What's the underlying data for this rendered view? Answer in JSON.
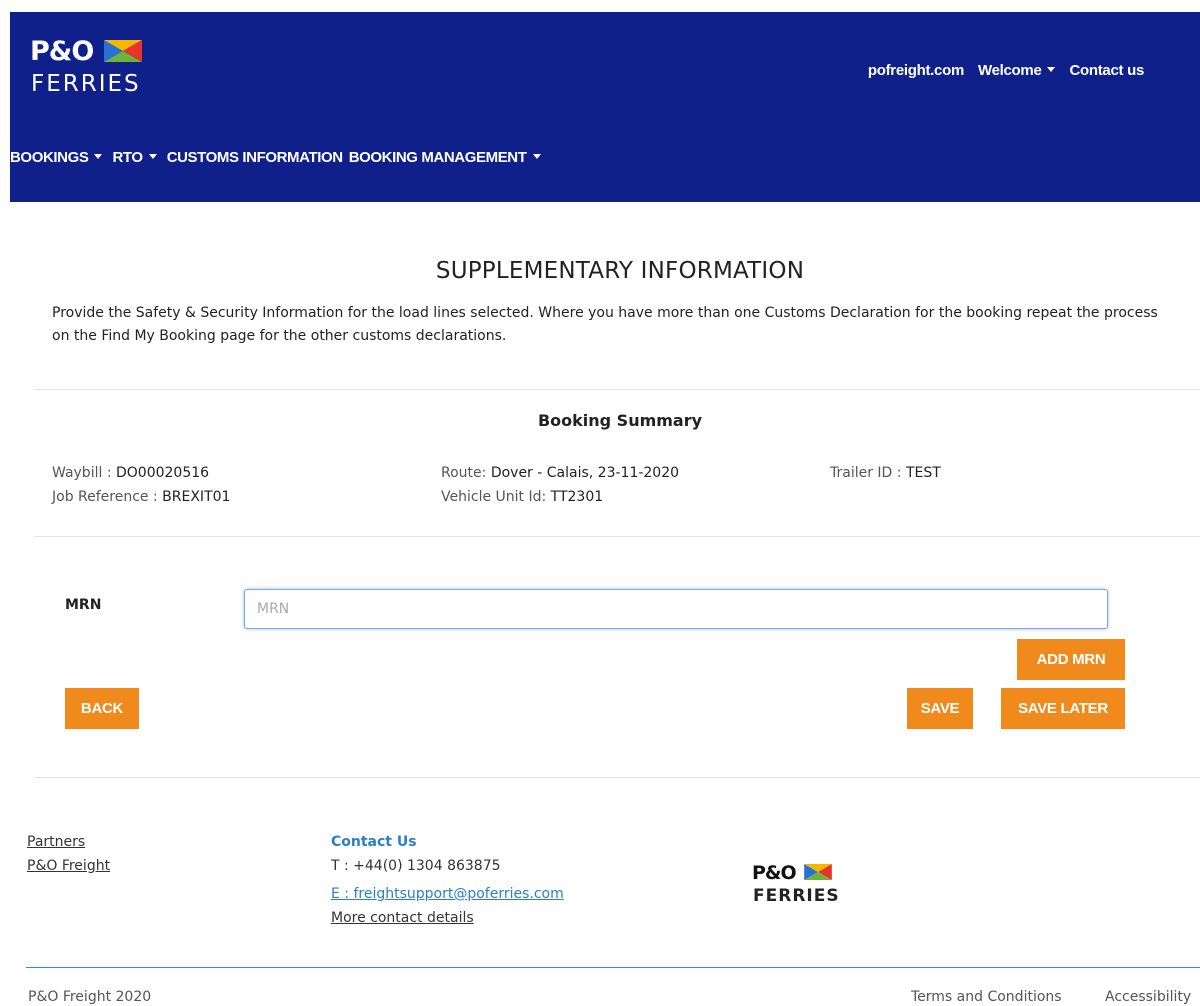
{
  "brand": {
    "logo_top": "P&O",
    "logo_bottom": "FERRIES",
    "colors": {
      "header_bg": "#10208a",
      "button": "#f08a1c",
      "link_blue": "#2a7fc7",
      "rule": "#2a8fd0"
    }
  },
  "header": {
    "links": [
      {
        "label": "pofreight.com",
        "dropdown": false
      },
      {
        "label": "Welcome",
        "dropdown": true
      },
      {
        "label": "Contact us",
        "dropdown": false
      }
    ],
    "nav": [
      {
        "label": "BOOKINGS",
        "dropdown": true
      },
      {
        "label": "RTO",
        "dropdown": true
      },
      {
        "label": "CUSTOMS INFORMATION",
        "dropdown": false
      },
      {
        "label": "BOOKING MANAGEMENT",
        "dropdown": true
      }
    ]
  },
  "page": {
    "title": "SUPPLEMENTARY INFORMATION",
    "intro": "Provide the Safety & Security Information for the load lines selected. Where you have more than one Customs Declaration for the booking repeat the process on the Find My Booking page for the other customs declarations."
  },
  "summary": {
    "title": "Booking Summary",
    "waybill_label": "Waybill : ",
    "waybill_value": "DO00020516",
    "job_label": "Job Reference : ",
    "job_value": "BREXIT01",
    "route_label": "Route: ",
    "route_value": "Dover - Calais, 23-11-2020",
    "vehicle_label": "Vehicle Unit Id: ",
    "vehicle_value": "TT2301",
    "trailer_label": "Trailer ID : ",
    "trailer_value": "TEST"
  },
  "form": {
    "mrn_label": "MRN",
    "mrn_placeholder": "MRN",
    "mrn_value": "",
    "add_mrn": "ADD MRN",
    "back": "BACK",
    "save": "SAVE",
    "save_later": "SAVE LATER"
  },
  "footer": {
    "partners": "Partners",
    "po_freight": "P&O Freight",
    "contact_title": "Contact Us",
    "phone": "T : +44(0) 1304 863875",
    "email": "E : freightsupport@poferries.com",
    "more_contact": "More contact details",
    "copyright": "P&O Freight 2020",
    "terms": "Terms and Conditions",
    "accessibility": "Accessibility"
  },
  "icons": [
    "caret-down-icon",
    "flag-icon"
  ]
}
